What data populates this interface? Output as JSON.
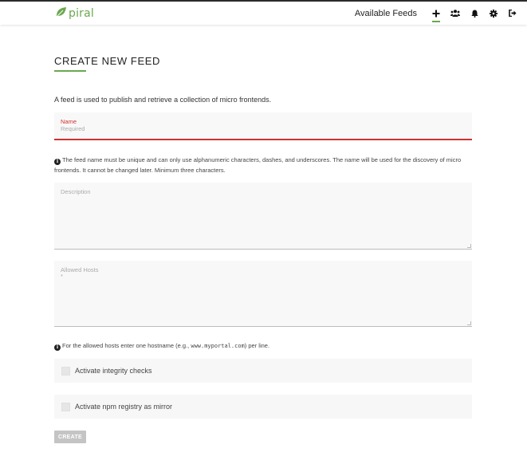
{
  "header": {
    "logo_text": "piral",
    "nav_link": "Available Feeds",
    "icons": [
      "plus-icon",
      "users-icon",
      "bell-icon",
      "gear-icon",
      "sign-out-icon"
    ],
    "accent_color": "#6aa84f"
  },
  "form": {
    "title": "CREATE NEW FEED",
    "intro": "A feed is used to publish and retrieve a collection of micro frontends.",
    "name_field": {
      "label": "Name",
      "placeholder": "Required",
      "error_color": "#d32f2f"
    },
    "name_hint": "The feed name must be unique and can only use alphanumeric characters, dashes, and underscores. The name will be used for the discovery of micro frontends. It cannot be changed later. Minimum three characters.",
    "description_field": {
      "placeholder": "Description"
    },
    "allowed_hosts_field": {
      "label": "Allowed Hosts",
      "value": "*"
    },
    "hosts_hint": {
      "before": "For the allowed hosts enter one hostname (e.g.,",
      "example": "www.myportal.com",
      "after": ") per line."
    },
    "integrity_checkbox": {
      "label": "Activate integrity checks",
      "checked": false
    },
    "mirror_checkbox": {
      "label": "Activate npm registry as mirror",
      "checked": false
    },
    "create_button": "CREATE"
  }
}
